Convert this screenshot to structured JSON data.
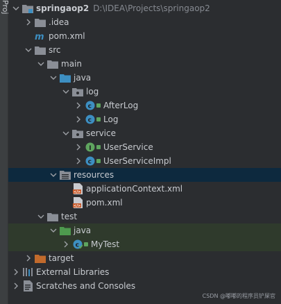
{
  "side_tab": {
    "label": "Proj"
  },
  "project": {
    "name": "springaop2",
    "path": "D:\\IDEA\\Projects\\springaop2"
  },
  "tree": {
    "idea": ".idea",
    "pom_root": "pom.xml",
    "src": "src",
    "main": "main",
    "java": "java",
    "log_pkg": "log",
    "afterlog": "AfterLog",
    "log_class": "Log",
    "service_pkg": "service",
    "userservice": "UserService",
    "userserviceimpl": "UserServiceImpl",
    "resources": "resources",
    "appctx": "applicationContext.xml",
    "pom_res": "pom.xml",
    "test": "test",
    "test_java": "java",
    "mytest": "MyTest",
    "target": "target",
    "external": "External Libraries",
    "scratches": "Scratches and Consoles"
  },
  "colors": {
    "selected_row": "#0d293e",
    "test_row": "#2f3a2c",
    "folder": "#8a8e96",
    "source_folder": "#3d8fc2",
    "test_folder": "#4e9a4e",
    "target_folder": "#c26a2c",
    "class_badge": "#3d8fc2",
    "interface_badge": "#5fa55f"
  },
  "icons": {
    "module": "module-folder-icon",
    "maven": "maven-m-icon",
    "class": "java-class-icon",
    "interface": "java-interface-icon",
    "xml": "xml-file-icon"
  },
  "watermark": "CSDN @嘟嘟的程序员铲屎官"
}
